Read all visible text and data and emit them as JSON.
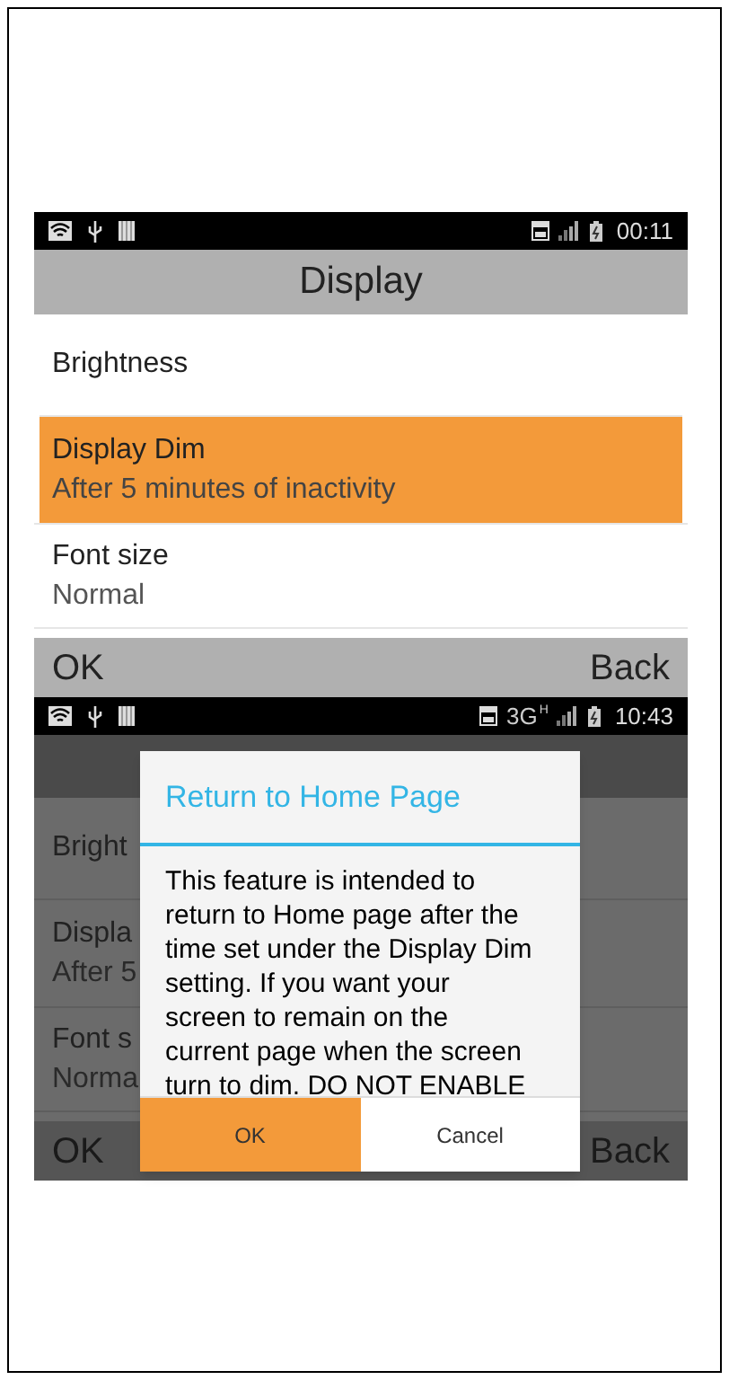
{
  "screens": [
    {
      "status_bar": {
        "time": "00:11"
      },
      "title": "Display",
      "dimmed": false,
      "items": [
        {
          "title": "Brightness",
          "selected": false
        },
        {
          "title": "Display Dim",
          "subtitle": "After 5 minutes of inactivity",
          "selected": true
        },
        {
          "title": "Font size",
          "subtitle": "Normal",
          "selected": false
        }
      ],
      "softkeys": {
        "left": "OK",
        "right": "Back"
      }
    },
    {
      "status_bar": {
        "network": "3G",
        "network_badge": "H",
        "time": "10:43"
      },
      "dimmed": true,
      "items": [
        {
          "title": "Bright",
          "selected": false
        },
        {
          "title": "Displa",
          "subtitle": "After 5",
          "selected": false
        },
        {
          "title": "Font s",
          "subtitle": "Norma",
          "selected": false
        }
      ],
      "softkeys": {
        "left": "OK",
        "right": "Back"
      },
      "dialog": {
        "title": "Return to Home Page",
        "message": "This feature is intended to return to Home page after the time set under the Display Dim setting. If you want your screen to remain on the current page when the screen turn to dim. DO NOT ENABLE",
        "buttons": [
          {
            "label": "OK",
            "selected": true
          },
          {
            "label": "Cancel",
            "selected": false
          }
        ]
      }
    }
  ]
}
